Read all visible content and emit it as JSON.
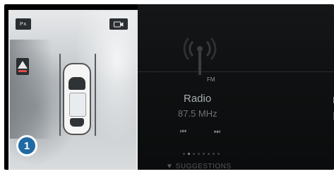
{
  "camera": {
    "left_button_label": "P∧",
    "right_button_icon": "camera-icon",
    "warning_icon": "warning-triangle-icon",
    "callout_number": "1",
    "callout_color": "#1f6aa3"
  },
  "radio": {
    "band": "FM",
    "station_name": "Radio",
    "frequency": "87.5 MHz",
    "prev_icon": "skip-previous-icon",
    "next_icon": "skip-next-icon",
    "prev_glyph": "⏮",
    "next_glyph": "⏭",
    "page_indicator": {
      "total": 8,
      "active": 2
    },
    "suggestions_label": "SUGGESTIONS",
    "suggestions_arrow": "▼",
    "peek_title": "N",
    "peek_sub": "|"
  }
}
